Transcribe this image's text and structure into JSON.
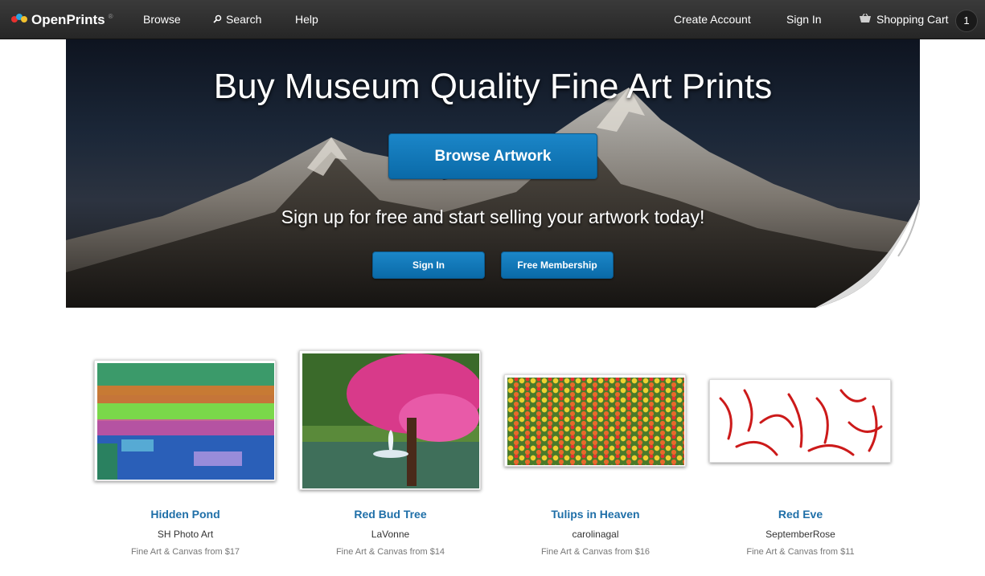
{
  "nav": {
    "logo": "OpenPrints",
    "logo_mark": "®",
    "browse": "Browse",
    "search": "Search",
    "help": "Help",
    "create_account": "Create Account",
    "sign_in": "Sign In",
    "cart": "Shopping Cart",
    "cart_count": "1"
  },
  "hero": {
    "title": "Buy Museum Quality Fine Art Prints",
    "browse_button": "Browse Artwork",
    "subtitle": "Sign up for free and start selling your artwork today!",
    "sign_in_button": "Sign In",
    "membership_button": "Free Membership"
  },
  "gallery": [
    {
      "title": "Hidden Pond",
      "artist": "SH Photo Art",
      "price": "Fine Art & Canvas from $17"
    },
    {
      "title": "Red Bud Tree",
      "artist": "LaVonne",
      "price": "Fine Art & Canvas from $14"
    },
    {
      "title": "Tulips in Heaven",
      "artist": "carolinagal",
      "price": "Fine Art & Canvas from $16"
    },
    {
      "title": "Red Eve",
      "artist": "SeptemberRose",
      "price": "Fine Art & Canvas from $11"
    }
  ],
  "colors": {
    "accent": "#0a6aa8",
    "link": "#1f6fa8",
    "navbar": "#2e2e2e"
  }
}
